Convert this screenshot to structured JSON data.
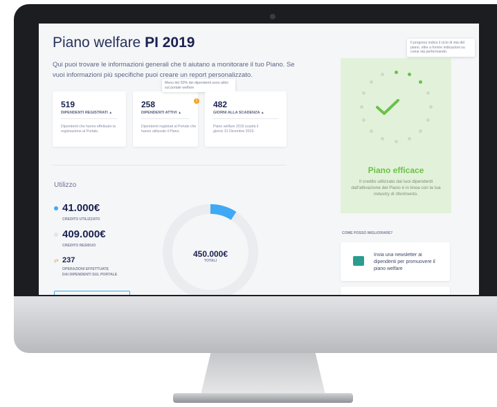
{
  "header": {
    "title_main": "Piano welfare ",
    "title_bold": "PI 2019",
    "intro": "Qui puoi trovare le informazioni generali che ti aiutano a monitorare il tuo Piano. Se vuoi informazioni più specifiche puoi creare un report personalizzato."
  },
  "cards": [
    {
      "value": "519",
      "label": "DIPENDENTI REGISTRATI",
      "desc": "Dipendenti che hanno effettuato la registrazione al Portale."
    },
    {
      "value": "258",
      "label": "DIPENDENTI ATTIVI",
      "desc": "Dipendenti registrati al Portale che hanno utilizzato il Piano."
    },
    {
      "value": "482",
      "label": "GIORNI ALLA SCADENZA",
      "desc": "Piano welfare 2019 scadrà il giorno 31 Dicembre 2019."
    }
  ],
  "tooltip": "Meno del 50% dei dipendenti sono attivi sul portale welfare",
  "warning_symbol": "!",
  "caret": "▲",
  "utilizzo": {
    "section_title": "Utilizzo",
    "credito_utilizzato": "41.000€",
    "credito_utilizzato_label": "CREDITO UTILIZZATO",
    "credito_residuo": "409.000€",
    "credito_residuo_label": "CREDITO RESIDUO",
    "operazioni": "237",
    "operazioni_label_1": "OPERAZIONI EFFETTUATE",
    "operazioni_label_2": "DAI DIPENDENTI SUL PORTALE",
    "totale": "450.000€",
    "totale_label": "TOTALI",
    "used_fraction": 0.091,
    "colors": {
      "used": "#3fa9f5",
      "residual": "#ebecef"
    }
  },
  "efficacia": {
    "info_tip": "Il progress indica il ciclo di vita del piano, oltre a fornire indicazioni su come sta performando.",
    "title": "Piano efficace",
    "text": "Il credito utilizzato dai tuoi dipendenti dall'attivazione del Piano è in linea con la tua industry di riferimento.",
    "progress_dots_active": 3,
    "progress_dots_total": 16,
    "color": "#6cc04a"
  },
  "migliorare": {
    "title": "COME POSSO MIGLIORARE?",
    "suggestion": "Invia una newsletter ai dipendenti per promuovere il piano welfare"
  }
}
